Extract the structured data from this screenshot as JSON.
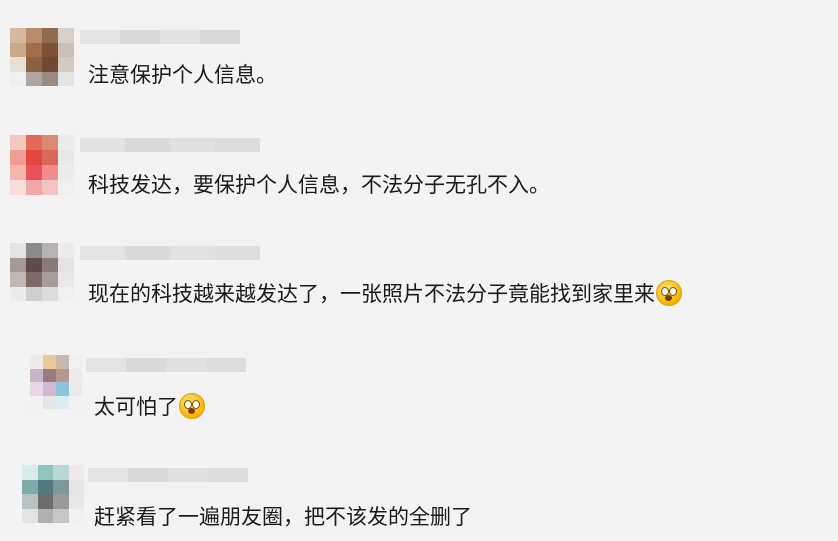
{
  "comments": [
    {
      "text": "注意保护个人信息。",
      "emoji": ""
    },
    {
      "text": "科技发达，要保护个人信息，不法分子无孔不入。",
      "emoji": ""
    },
    {
      "text": "现在的科技越来越发达了，一张照片不法分子竟能找到家里来",
      "emoji": "shocked-face-icon"
    },
    {
      "text": "太可怕了",
      "emoji": "shocked-face-icon"
    },
    {
      "text": "赶紧看了一遍朋友圈，把不该发的全删了",
      "emoji": ""
    }
  ],
  "colors": {
    "background": "#f3f3f3",
    "text": "#1a1a1a"
  }
}
